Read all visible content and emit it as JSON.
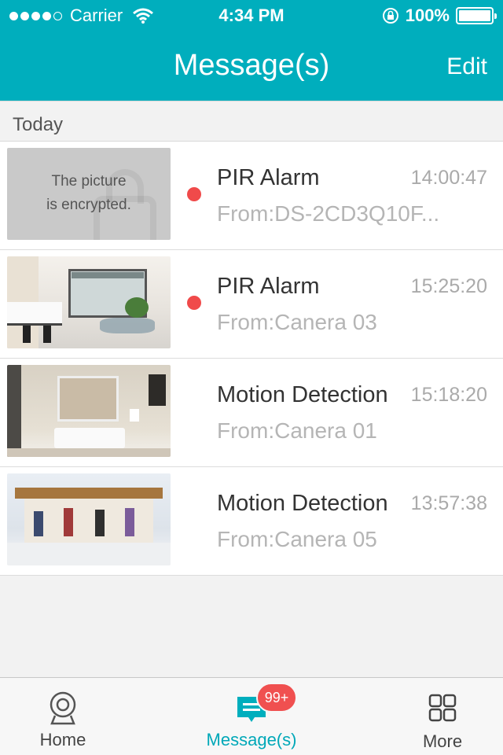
{
  "status_bar": {
    "carrier": "Carrier",
    "time": "4:34 PM",
    "battery": "100%"
  },
  "nav": {
    "title": "Message(s)",
    "edit_label": "Edit"
  },
  "section": {
    "title": "Today"
  },
  "messages": [
    {
      "title": "PIR Alarm",
      "time": "14:00:47",
      "from": "From:DS-2CD3Q10F...",
      "unread": true,
      "thumb": "encrypted",
      "thumb_text_1": "The picture",
      "thumb_text_2": "is encrypted."
    },
    {
      "title": "PIR Alarm",
      "time": "15:25:20",
      "from": "From:Canera 03",
      "unread": true,
      "thumb": "kitchen"
    },
    {
      "title": "Motion Detection",
      "time": "15:18:20",
      "from": "From:Canera 01",
      "unread": false,
      "thumb": "living-room"
    },
    {
      "title": "Motion Detection",
      "time": "13:57:38",
      "from": "From:Canera 05",
      "unread": false,
      "thumb": "store"
    }
  ],
  "tabbar": {
    "home": "Home",
    "messages": "Message(s)",
    "messages_badge": "99+",
    "more": "More"
  },
  "colors": {
    "accent": "#00aebd",
    "unread_dot": "#f04a4a",
    "badge": "#f05050"
  },
  "icons": [
    "wifi-icon",
    "rotation-lock-icon",
    "battery-icon",
    "camera-icon",
    "message-icon",
    "grid-icon"
  ]
}
